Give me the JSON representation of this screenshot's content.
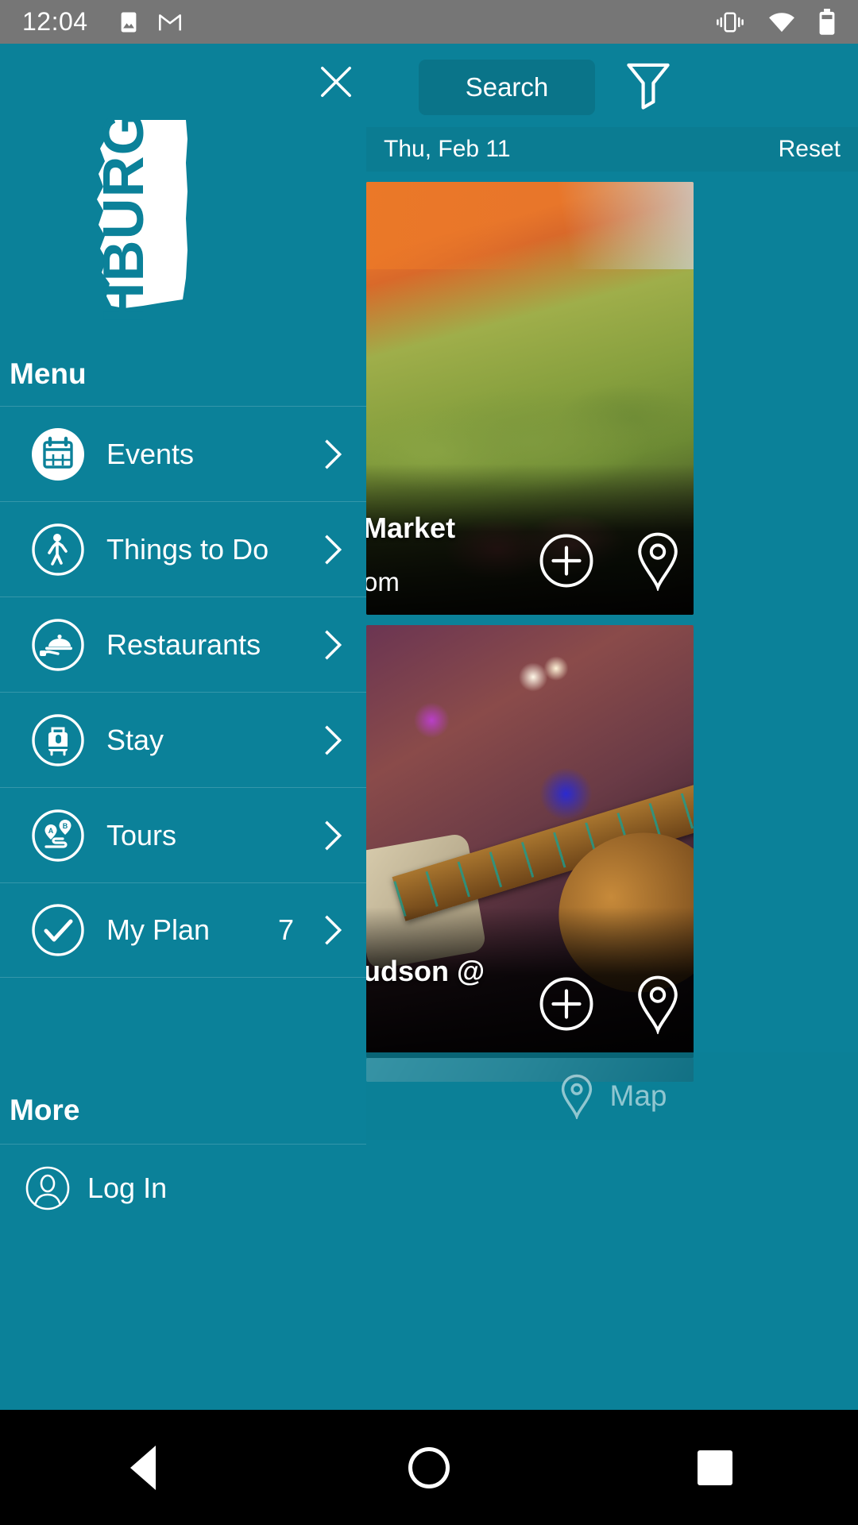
{
  "status_bar": {
    "time": "12:04",
    "left_icons": [
      "image-icon",
      "gmail-icon"
    ],
    "right_icons": [
      "vibrate-icon",
      "wifi-icon",
      "battery-icon"
    ]
  },
  "drawer": {
    "close_label": "close-icon",
    "logo_text": "HBURG",
    "menu_heading": "Menu",
    "items": [
      {
        "label": "Events",
        "icon": "calendar-icon",
        "count": ""
      },
      {
        "label": "Things to Do",
        "icon": "walking-person-icon",
        "count": ""
      },
      {
        "label": "Restaurants",
        "icon": "serving-tray-icon",
        "count": ""
      },
      {
        "label": "Stay",
        "icon": "suitcase-icon",
        "count": ""
      },
      {
        "label": "Tours",
        "icon": "map-pins-route-icon",
        "count": ""
      },
      {
        "label": "My Plan",
        "icon": "check-circle-icon",
        "count": "7"
      }
    ],
    "more_heading": "More",
    "more_items": [
      {
        "label": "Log In",
        "icon": "user-avatar-icon"
      }
    ]
  },
  "content": {
    "search_label": "Search",
    "filter_icon": "filter-funnel-icon",
    "date_bar": {
      "date": "Thu, Feb 11",
      "reset_label": "Reset"
    },
    "cards": [
      {
        "title": "Market",
        "subtitle": "om",
        "add_icon": "plus-circle-icon",
        "map_icon": "map-pin-icon"
      },
      {
        "title": "udson @",
        "subtitle": "",
        "add_icon": "plus-circle-icon",
        "map_icon": "map-pin-icon"
      }
    ],
    "map_bar": {
      "label": "Map",
      "icon": "map-pin-icon"
    }
  },
  "nav_bar": {
    "back": "back-triangle-icon",
    "home": "home-circle-icon",
    "recents": "recents-square-icon"
  },
  "colors": {
    "brand_teal": "#0b8199",
    "search_teal": "#0a7489",
    "date_bar_teal": "#0b7c92",
    "status_gray": "#767676"
  }
}
